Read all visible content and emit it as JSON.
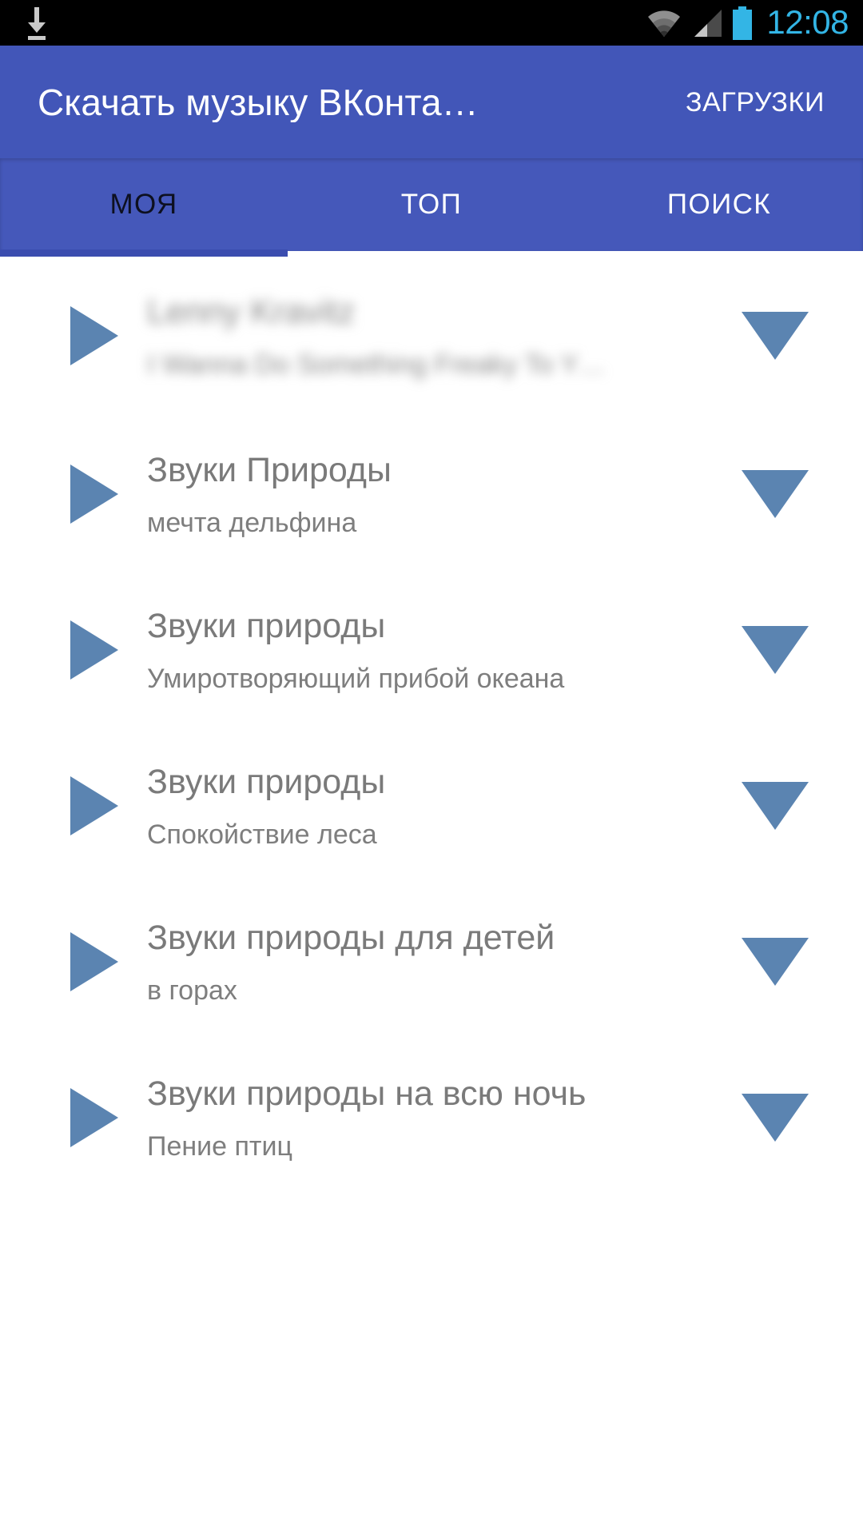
{
  "status_bar": {
    "notification_icon": "download-icon",
    "wifi_icon": "wifi-icon",
    "signal_icon": "cellular-signal-icon",
    "battery_icon": "battery-icon",
    "clock": "12:08",
    "clock_color": "#33b5e5"
  },
  "app_bar": {
    "title": "Скачать музыку ВКонта…",
    "action_label": "ЗАГРУЗКИ",
    "background_color": "#4256b8",
    "text_color": "#ffffff"
  },
  "tabs": {
    "background_color": "#4558ba",
    "active_index": 0,
    "indicator_color": "#3b4daf",
    "active_text_color": "#0d1020",
    "inactive_text_color": "#ffffff",
    "items": [
      {
        "label": "МОЯ"
      },
      {
        "label": "ТОП"
      },
      {
        "label": "ПОИСК"
      }
    ]
  },
  "list": {
    "play_icon_color": "#5b84b1",
    "download_icon_color": "#5b84b1",
    "title_color": "#7a7a7a",
    "subtitle_color": "#7e7e7e",
    "items": [
      {
        "title": "Lenny Kravitz",
        "subtitle": "I Wanna Do Something Freaky To Y…",
        "blurred": true,
        "play_icon": "play-icon",
        "download_icon": "download-triangle-icon"
      },
      {
        "title": "Звуки Природы",
        "subtitle": "мечта дельфина",
        "blurred": false,
        "play_icon": "play-icon",
        "download_icon": "download-triangle-icon"
      },
      {
        "title": "Звуки природы",
        "subtitle": "Умиротворяющий прибой океана",
        "blurred": false,
        "play_icon": "play-icon",
        "download_icon": "download-triangle-icon"
      },
      {
        "title": "Звуки природы",
        "subtitle": "Спокойствие леса",
        "blurred": false,
        "play_icon": "play-icon",
        "download_icon": "download-triangle-icon"
      },
      {
        "title": "Звуки природы для детей",
        "subtitle": "в горах",
        "blurred": false,
        "play_icon": "play-icon",
        "download_icon": "download-triangle-icon"
      },
      {
        "title": "Звуки природы на всю ночь",
        "subtitle": "Пение птиц",
        "blurred": false,
        "play_icon": "play-icon",
        "download_icon": "download-triangle-icon"
      }
    ]
  }
}
